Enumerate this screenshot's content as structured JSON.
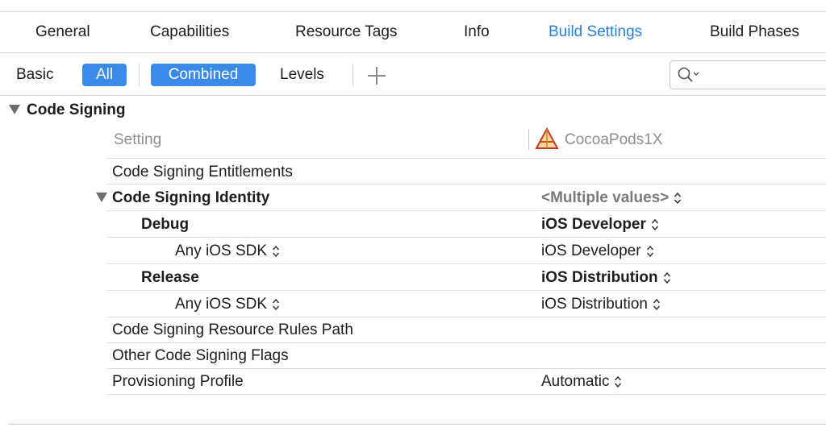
{
  "tabs": [
    {
      "label": "General",
      "active": false
    },
    {
      "label": "Capabilities",
      "active": false
    },
    {
      "label": "Resource Tags",
      "active": false
    },
    {
      "label": "Info",
      "active": false
    },
    {
      "label": "Build Settings",
      "active": true
    },
    {
      "label": "Build Phases",
      "active": false
    }
  ],
  "filter": {
    "basic": "Basic",
    "all": "All",
    "combined": "Combined",
    "levels": "Levels",
    "add_icon": "plus-icon",
    "search_icon": "magnifier-icon"
  },
  "section": {
    "title": "Code Signing"
  },
  "columns": {
    "setting": "Setting",
    "target": "CocoaPods1X",
    "target_icon": "app-target-icon"
  },
  "rows": [
    {
      "setting": "Code Signing Entitlements",
      "value": ""
    },
    {
      "setting": "Code Signing Identity",
      "value": "<Multiple values>",
      "bold": true,
      "expanded": true
    },
    {
      "setting": "Debug",
      "value": "iOS Developer",
      "bold": true
    },
    {
      "setting": "Any iOS SDK",
      "value": "iOS Developer"
    },
    {
      "setting": "Release",
      "value": "iOS Distribution",
      "bold": true
    },
    {
      "setting": "Any iOS SDK",
      "value": "iOS Distribution"
    },
    {
      "setting": "Code Signing Resource Rules Path",
      "value": ""
    },
    {
      "setting": "Other Code Signing Flags",
      "value": ""
    },
    {
      "setting": "Provisioning Profile",
      "value": "Automatic"
    }
  ],
  "colors": {
    "accent": "#3a8be8",
    "active_tab": "#2a7fd9",
    "muted": "#8e8e93"
  }
}
